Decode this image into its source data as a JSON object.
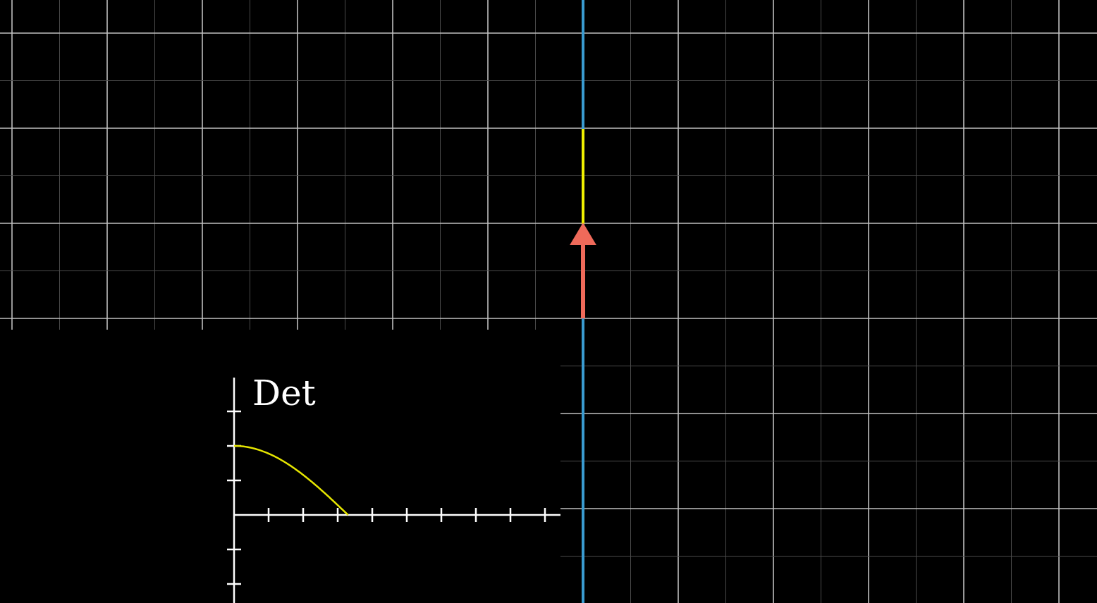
{
  "scene": {
    "background": "#000000",
    "grid_major_color": "#bfbfbf",
    "grid_minor_color": "#4a4a4a",
    "axis_color": "#3a9bd0",
    "basis_j_color": "#f0f000",
    "basis_i_color": "#ef6a5a"
  },
  "inset_plot": {
    "title": "Det",
    "axis_color": "#ffffff",
    "curve_color": "#e6e600",
    "x_tick_count": 9,
    "y_ticks_above": 3,
    "y_ticks_below": 2,
    "curve": {
      "type": "cosine-decay",
      "start_value": 1,
      "zero_at_tick": 3.3
    }
  }
}
